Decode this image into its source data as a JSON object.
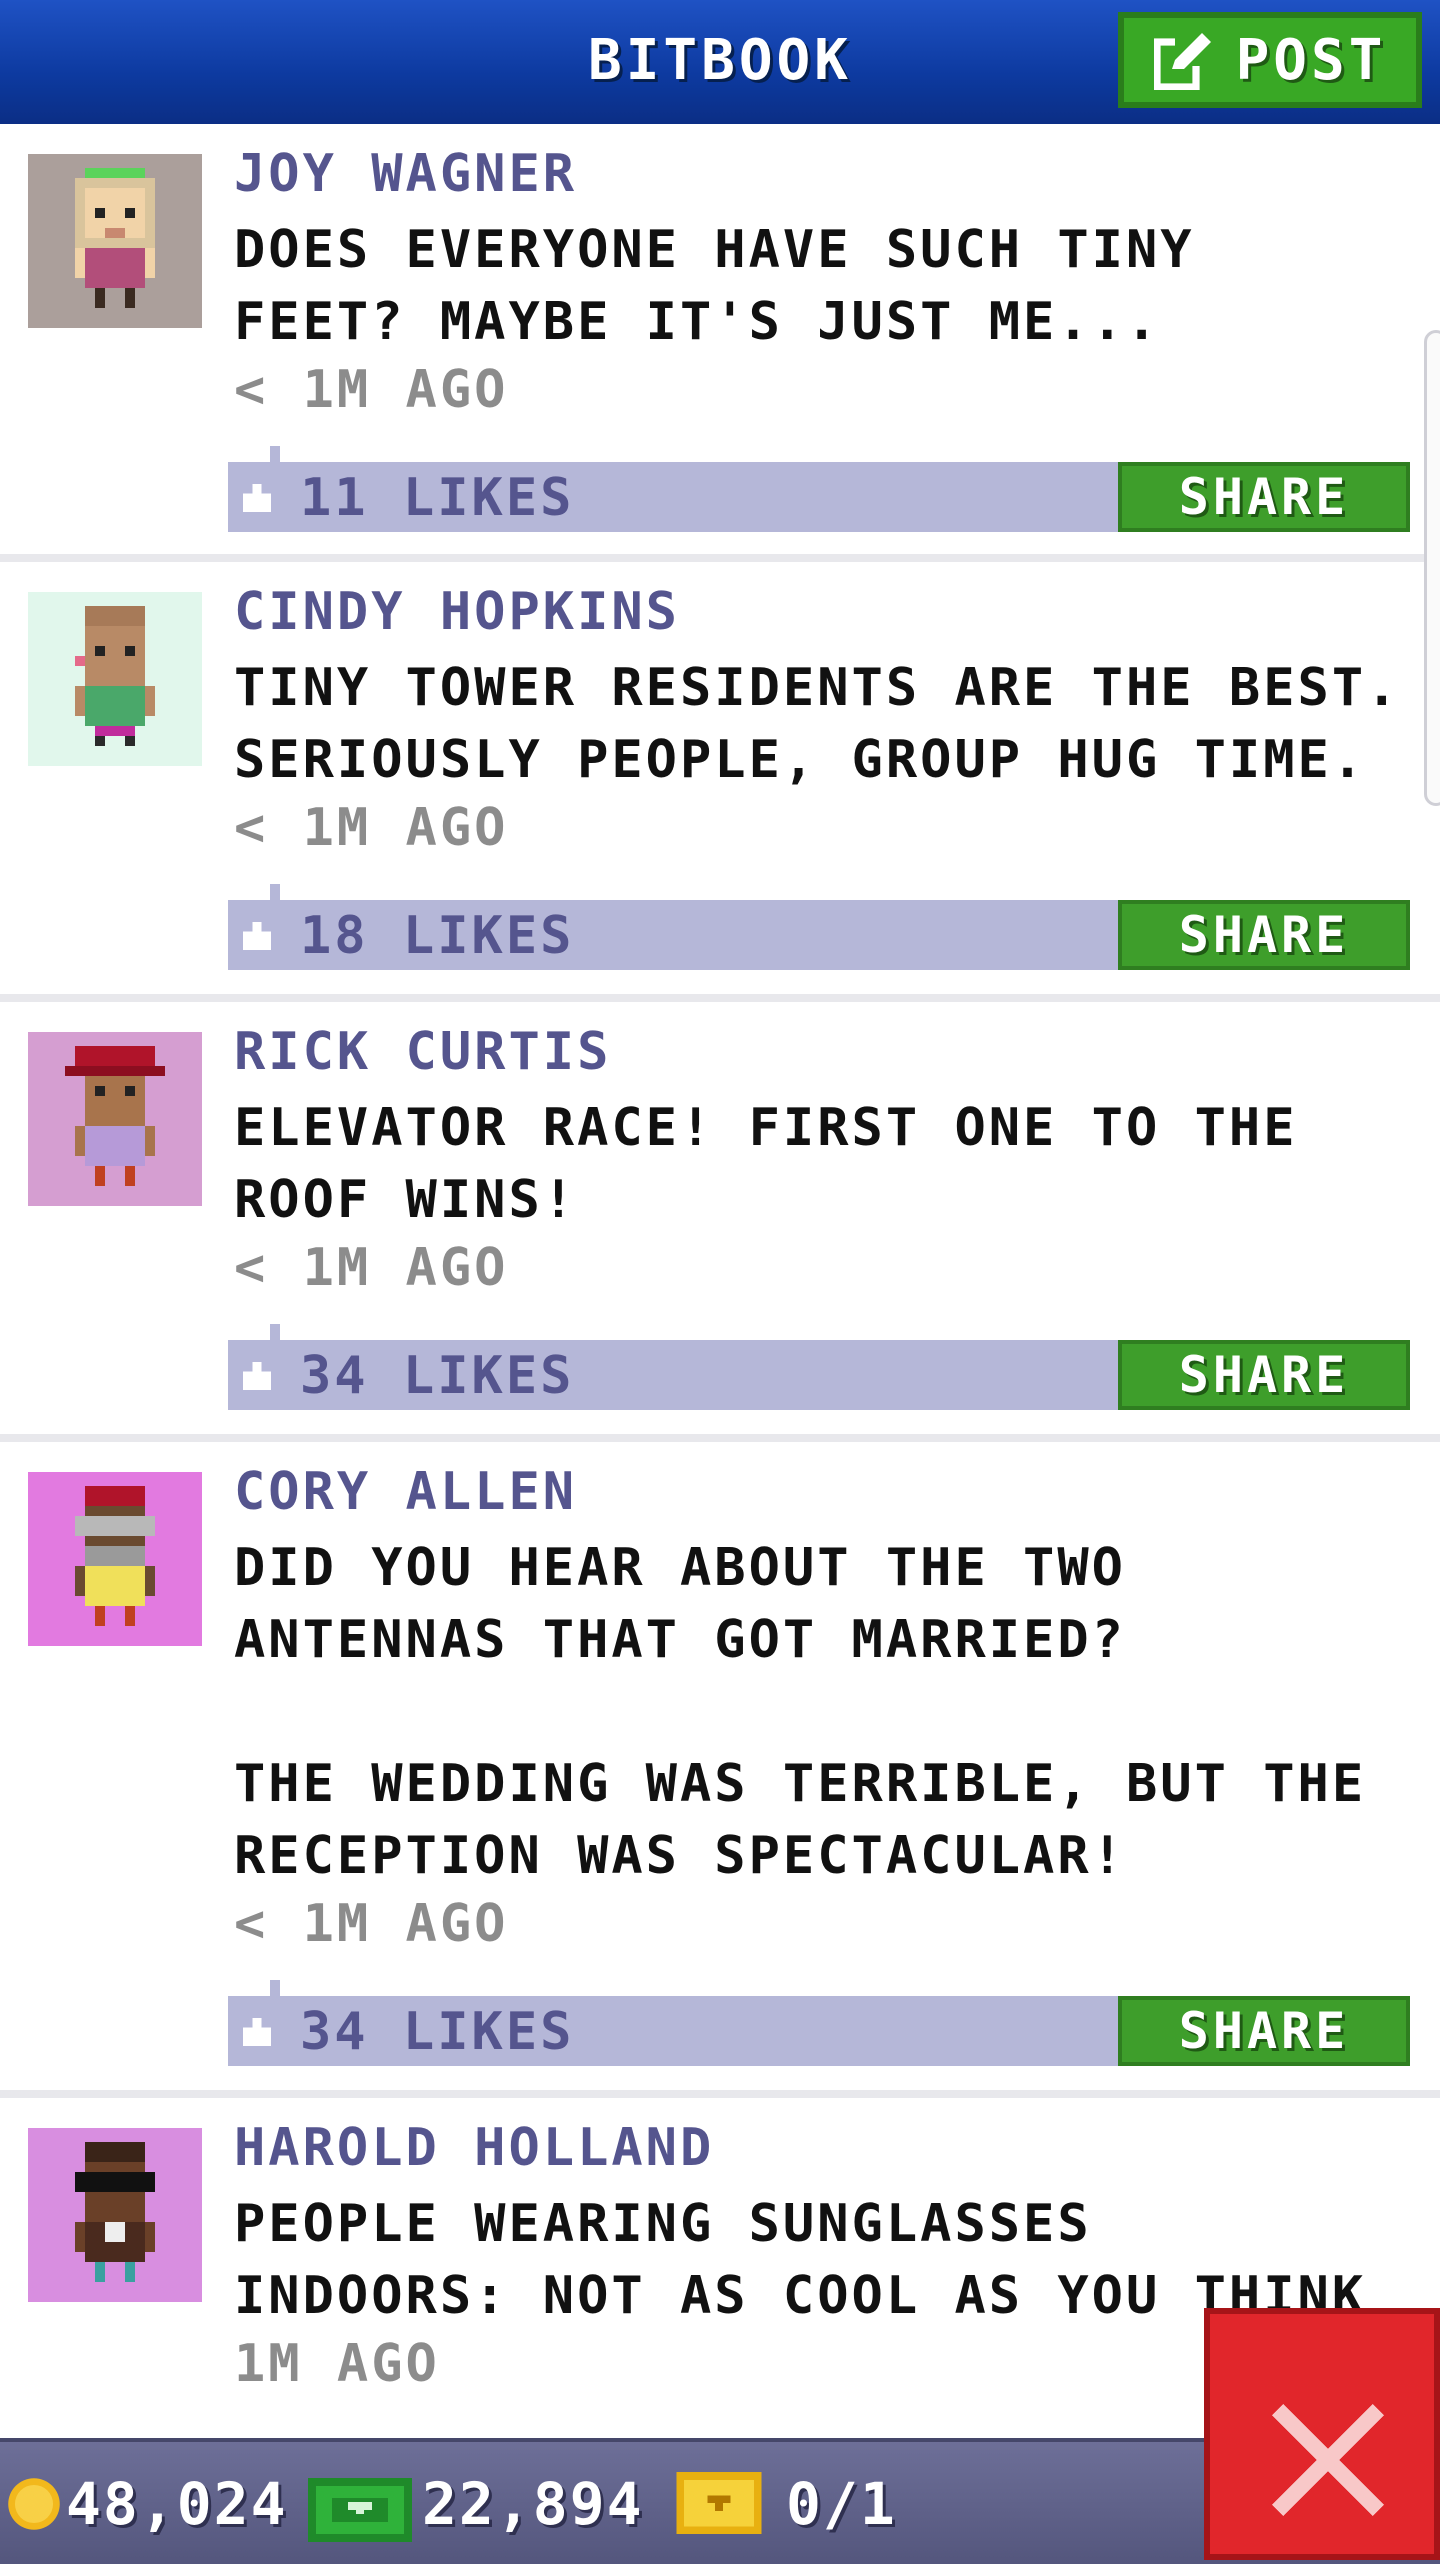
{
  "header": {
    "title": "BITBOOK",
    "post_label": "POST"
  },
  "posts": [
    {
      "author": "JOY WAGNER",
      "message": "DOES EVERYONE HAVE SUCH TINY\nFEET? MAYBE IT'S JUST ME...",
      "time": "< 1M AGO",
      "likes": "11 LIKES",
      "share_label": "SHARE",
      "avatar_bg": "#ab9f9b"
    },
    {
      "author": "CINDY HOPKINS",
      "message": "TINY TOWER RESIDENTS ARE THE BEST.\nSERIOUSLY PEOPLE, GROUP HUG TIME.",
      "time": "< 1M AGO",
      "likes": "18 LIKES",
      "share_label": "SHARE",
      "avatar_bg": "#e1f7ec"
    },
    {
      "author": "RICK CURTIS",
      "message": "ELEVATOR RACE! FIRST ONE TO THE\nROOF WINS!",
      "time": "< 1M AGO",
      "likes": "34 LIKES",
      "share_label": "SHARE",
      "avatar_bg": "#d59ed1"
    },
    {
      "author": "CORY ALLEN",
      "message": "DID YOU HEAR ABOUT THE TWO\nANTENNAS THAT GOT MARRIED?\n\nTHE WEDDING WAS TERRIBLE, BUT THE\nRECEPTION WAS SPECTACULAR!",
      "time": "< 1M AGO",
      "likes": "34 LIKES",
      "share_label": "SHARE",
      "avatar_bg": "#e27ae0"
    },
    {
      "author": "HAROLD HOLLAND",
      "message": "PEOPLE WEARING SUNGLASSES\nINDOORS: NOT AS COOL AS YOU THINK",
      "time": "1M AGO",
      "avatar_bg": "#d88ee0"
    }
  ],
  "bottom_bar": {
    "coins": "48,024",
    "bux": "22,894",
    "tickets": "0/1"
  },
  "colors": {
    "header_blue": "#1646b4",
    "share_green": "#3e9e2b",
    "likes_bar": "#b5b7d8",
    "close_red": "#e1262b"
  }
}
